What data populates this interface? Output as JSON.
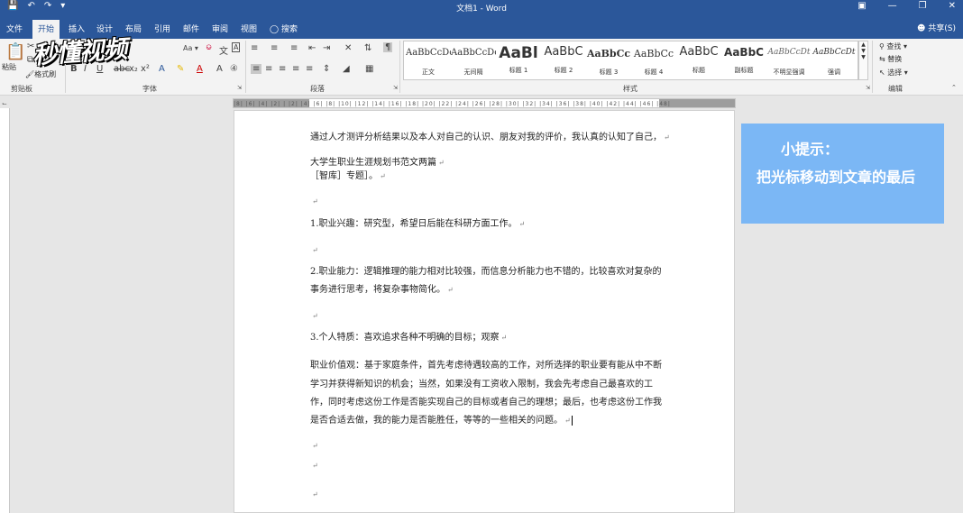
{
  "window": {
    "title": "文档1 - Word",
    "share": "共享(S)"
  },
  "tabs": [
    "文件",
    "开始",
    "插入",
    "设计",
    "布局",
    "引用",
    "邮件",
    "审阅",
    "视图"
  ],
  "search": "搜索",
  "watermark": "秒懂视频",
  "clipboard": {
    "paste": "粘贴",
    "format_painter": "格式刷",
    "label": "剪贴板"
  },
  "font": {
    "label": "字体"
  },
  "paragraph": {
    "label": "段落"
  },
  "styles": {
    "label": "样式",
    "items": [
      {
        "sample": "AaBbCcDc",
        "name": "正文"
      },
      {
        "sample": "AaBbCcDc",
        "name": "无间隔"
      },
      {
        "sample": "AaBl",
        "name": "标题 1"
      },
      {
        "sample": "AaBbC",
        "name": "标题 2"
      },
      {
        "sample": "AaBbCc",
        "name": "标题 3"
      },
      {
        "sample": "AaBbCc",
        "name": "标题 4"
      },
      {
        "sample": "AaBbC",
        "name": "标题"
      },
      {
        "sample": "AaBbC",
        "name": "副标题"
      },
      {
        "sample": "AaBbCcDt",
        "name": "不明显强调"
      },
      {
        "sample": "AaBbCcDt",
        "name": "强调"
      }
    ]
  },
  "editing": {
    "find": "查找",
    "replace": "替换",
    "select": "选择",
    "label": "编辑"
  },
  "ruler": "|8| |6| |4| |2| | |2| |4| |6| |8| |10| |12| |14| |16| |18| |20| |22| |24| |26| |28| |30| |32| |34| |36| |38| |40| |42| |44| |46| |48|",
  "document": {
    "lines": [
      "通过人才测评分析结果以及本人对自己的认识、朋友对我的评价，我认真的认知了自己，",
      "大学生职业生涯规划书范文两篇",
      "［智库］专题］。",
      "",
      "1.职业兴趣：研究型，希望日后能在科研方面工作。",
      "",
      "2.职业能力：逻辑推理的能力相对比较强，而信息分析能力也不错的，比较喜欢对复杂的",
      "事务进行思考，将复杂事物简化。",
      "",
      "3.个人特质：喜欢追求各种不明确的目标；观察",
      "职业价值观：基于家庭条件，首先考虑待遇较高的工作，对所选择的职业要有能从中不断",
      "学习并获得新知识的机会；当然，如果没有工资收入限制，我会先考虑自己最喜欢的工",
      "作，同时考虑这份工作是否能实现自己的目标或者自己的理想；最后，也考虑这份工作我",
      "是否合适去做，我的能力是否能胜任，等等的一些相关的问题。",
      "",
      "",
      ""
    ]
  },
  "tip": {
    "title": "小提示：",
    "text": "把光标移动到文章的最后"
  }
}
